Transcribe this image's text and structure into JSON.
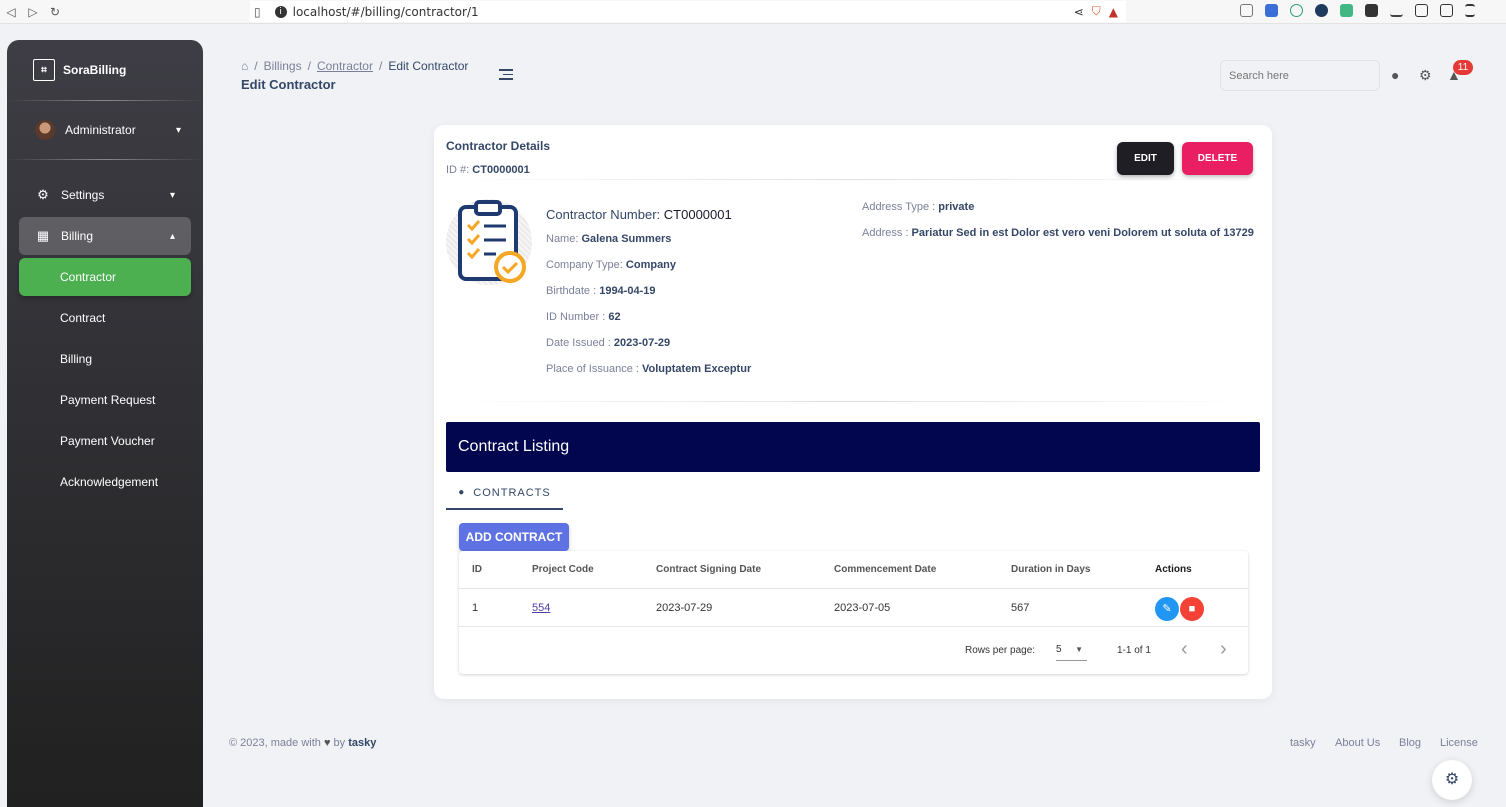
{
  "browser": {
    "url": "localhost/#/billing/contractor/1"
  },
  "sidebar": {
    "brand": "SoraBilling",
    "user": "Administrator",
    "items": [
      {
        "label": "Settings"
      },
      {
        "label": "Billing"
      }
    ],
    "subitems": [
      {
        "label": "Contractor"
      },
      {
        "label": "Contract"
      },
      {
        "label": "Billing"
      },
      {
        "label": "Payment Request"
      },
      {
        "label": "Payment Voucher"
      },
      {
        "label": "Acknowledgement"
      }
    ]
  },
  "header": {
    "breadcrumb": [
      "Billings",
      "Contractor",
      "Edit Contractor"
    ],
    "title": "Edit Contractor",
    "search_placeholder": "Search here",
    "notification_count": "11"
  },
  "card": {
    "title": "Contractor Details",
    "id_label": "ID #:",
    "id_value": "CT0000001",
    "edit_label": "EDIT",
    "delete_label": "DELETE",
    "contractor_number_label": "Contractor Number:",
    "contractor_number": "CT0000001",
    "fields": [
      {
        "label": "Name:",
        "value": "Galena Summers"
      },
      {
        "label": "Company Type:",
        "value": "Company"
      },
      {
        "label": "Birthdate :",
        "value": "1994-04-19"
      },
      {
        "label": "ID Number :",
        "value": "62"
      },
      {
        "label": "Date Issued :",
        "value": "2023-07-29"
      },
      {
        "label": "Place of Issuance :",
        "value": "Voluptatem Exceptur"
      }
    ],
    "address_type_label": "Address Type :",
    "address_type": "private",
    "address_label": "Address :",
    "address": "Pariatur Sed in est Dolor est vero veni Dolorem ut soluta of 13729"
  },
  "listing": {
    "title": "Contract Listing",
    "tab": "CONTRACTS",
    "add_label": "ADD CONTRACT",
    "columns": [
      "ID",
      "Project Code",
      "Contract Signing Date",
      "Commencement Date",
      "Duration in Days",
      "Actions"
    ],
    "rows": [
      {
        "id": "1",
        "project_code": "554",
        "signing_date": "2023-07-29",
        "commencement_date": "2023-07-05",
        "duration": "567"
      }
    ],
    "rows_per_page_label": "Rows per page:",
    "rows_per_page": "5",
    "page_info": "1-1 of 1"
  },
  "footer": {
    "copyright": "© 2023, made with",
    "by": "by",
    "brand": "tasky",
    "links": [
      "tasky",
      "About Us",
      "Blog",
      "License"
    ]
  }
}
